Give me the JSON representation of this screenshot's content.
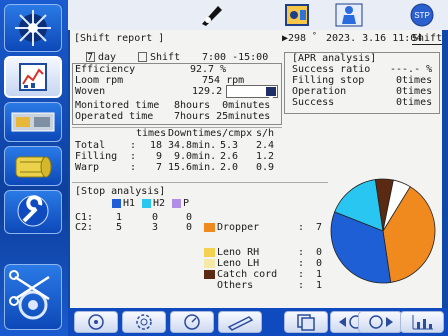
{
  "header": {
    "title": "[Shift report ]",
    "loom_no": "▶298",
    "superscript": "°",
    "datetime": "2023. 3.16 11:04",
    "shift_label": "Shift"
  },
  "period": {
    "day_checkbox": "7",
    "day_label": "day",
    "shift_label": "Shift",
    "time_range": "7:00 -15:00"
  },
  "stats": [
    {
      "label": "Efficiency",
      "value": "92.7 %"
    },
    {
      "label": "Loom rpm",
      "value": "754 rpm"
    },
    {
      "label": "Woven",
      "value": "129.2"
    },
    {
      "label": "Monitored time",
      "value": "8hours  0minutes"
    },
    {
      "label": "Operated time",
      "value": "7hours 25minutes"
    }
  ],
  "woven_dropdown": "",
  "apr": {
    "title": "[APR analysis]",
    "rows": [
      {
        "label": "Success ratio",
        "value": "---.- %"
      },
      {
        "label": "Filling stop",
        "value": "0times"
      },
      {
        "label": "Operation",
        "value": "0times"
      },
      {
        "label": "Success",
        "value": "0times"
      }
    ]
  },
  "stops_table": {
    "headers": [
      "times",
      "Downtime",
      "s/cmpx",
      "s/h"
    ],
    "rows": [
      {
        "label": "Total",
        "sep": ":",
        "times": "18",
        "downtime": "34.8min.",
        "scmpx": "5.3",
        "sh": "2.4"
      },
      {
        "label": "Filling",
        "sep": ":",
        "times": "9",
        "downtime": "9.0min.",
        "scmpx": "2.6",
        "sh": "1.2"
      },
      {
        "label": "Warp",
        "sep": ":",
        "times": "7",
        "downtime": "15.6min.",
        "scmpx": "2.0",
        "sh": "0.9"
      }
    ]
  },
  "stop_analysis": {
    "title": "[Stop analysis]",
    "legend": [
      {
        "label": "H1",
        "color": "#1f5fd6"
      },
      {
        "label": "H2",
        "color": "#29c6f2"
      },
      {
        "label": "P",
        "color": "#b08ee8"
      }
    ],
    "rows": [
      {
        "label": "C1:",
        "h1": "1",
        "h2": "0",
        "p": "0"
      },
      {
        "label": "C2:",
        "h1": "5",
        "h2": "3",
        "p": "0"
      }
    ],
    "causes": [
      {
        "label": "Dropper",
        "value": "7",
        "color": "#f08a1f"
      },
      {
        "label": "Leno RH",
        "value": "0",
        "color": "#f2d250"
      },
      {
        "label": "Leno LH",
        "value": "0",
        "color": "#f5e9a8"
      },
      {
        "label": "Catch cord",
        "value": "1",
        "color": "#5a2a12"
      },
      {
        "label": "Others",
        "value": "1",
        "color": ""
      }
    ],
    "pie": [
      {
        "label": "Dropper",
        "value": 7,
        "color": "#f08a1f"
      },
      {
        "label": "H1",
        "value": 6,
        "color": "#1f5fd6"
      },
      {
        "label": "H2",
        "value": 3,
        "color": "#29c6f2"
      },
      {
        "label": "Catch cord",
        "value": 1,
        "color": "#5a2a12"
      },
      {
        "label": "Others",
        "value": 1,
        "color": "#ffffff"
      }
    ]
  },
  "colors": {
    "panel_bg": "#f3f4f2",
    "sidebar": "#1a5bd0",
    "accent": "#0f4bbf"
  },
  "icons": {
    "sidebar": [
      "starburst-icon",
      "chart-report-icon",
      "machine-icon",
      "fabric-roll-icon",
      "wrench-icon",
      "scissors-gear-icon"
    ],
    "top": [
      "scissors-icon",
      "badge-icon",
      "operator-icon",
      "stop-icon"
    ],
    "bottom": [
      "gear-icon",
      "gear-settings-icon",
      "rpm-gauge-icon",
      "pencil-icon",
      "copy-icon",
      "prev-gear-icon",
      "next-gear-icon",
      "chart-icon"
    ]
  }
}
